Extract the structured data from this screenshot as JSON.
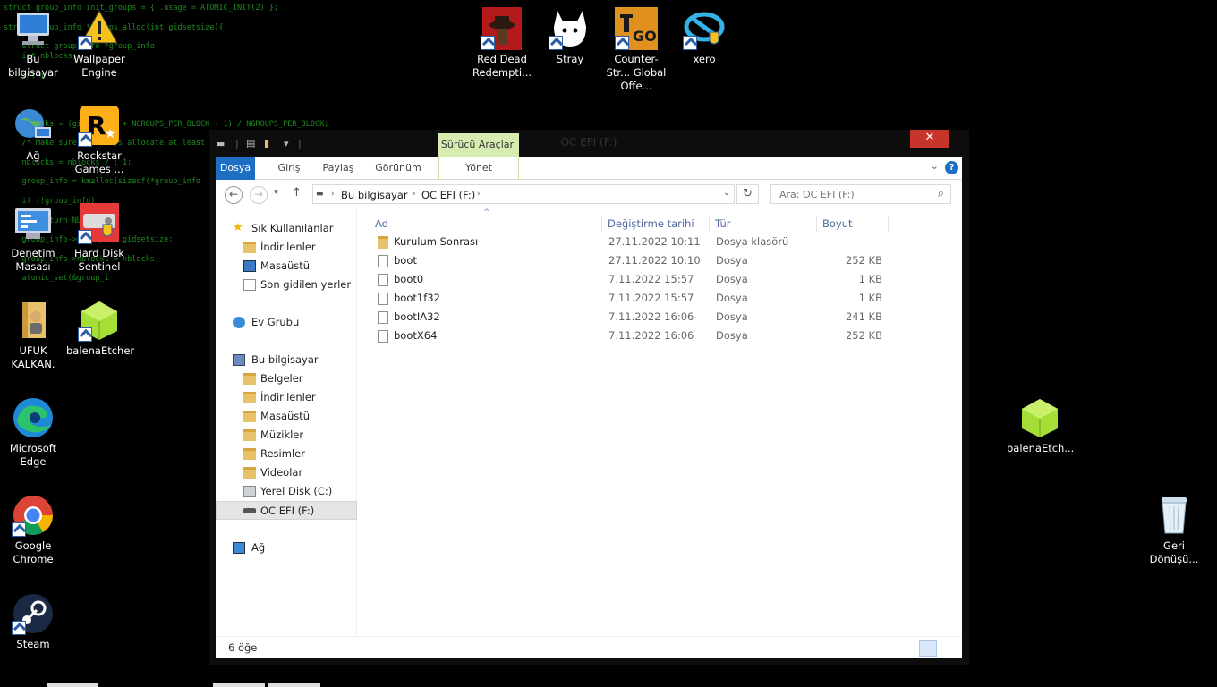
{
  "desktop": {
    "code_lines": [
      "struct group_info init_groups = { .usage = ATOMIC_INIT(2) };",
      "",
      "struct group_info *groups_alloc(int gidsetsize){",
      "",
      "    struct group_info *group_info;",
      "    int nblocks;",
      "",
      "    int i;",
      "",
      "",
      "",
      "",
      "    nblocks = (gidsetsize + NGROUPS_PER_BLOCK - 1) / NGROUPS_PER_BLOCK;",
      "",
      "    /* Make sure we always allocate at least",
      "",
      "    nblocks = nblocks ? : 1;",
      "",
      "    group_info = kmalloc(sizeof(*group_info",
      "",
      "    if (!group_info)",
      "",
      "        return NULL;",
      "",
      "    group_info->ngroups = gidsetsize;",
      "",
      "    group_info->nblocks = nblocks;",
      "",
      "    atomic_set(&group_i"
    ],
    "icons": [
      {
        "label": "Bu bilgisayar",
        "icon": "computer-icon"
      },
      {
        "label": "Wallpaper Engine",
        "icon": "wallpaper-engine-icon"
      },
      {
        "label": "Ağ",
        "icon": "network-globe-icon"
      },
      {
        "label": "Rockstar Games ...",
        "icon": "rockstar-icon"
      },
      {
        "label": "Denetim Masası",
        "icon": "control-panel-icon"
      },
      {
        "label": "Hard Disk Sentinel",
        "icon": "hard-disk-sentinel-icon"
      },
      {
        "label": "UFUK KALKAN.",
        "icon": "user-folder-icon"
      },
      {
        "label": "balenaEtcher",
        "icon": "balena-etcher-icon"
      },
      {
        "label": "Microsoft Edge",
        "icon": "edge-icon"
      },
      {
        "label": "Google Chrome",
        "icon": "chrome-icon"
      },
      {
        "label": "Steam",
        "icon": "steam-icon"
      },
      {
        "label": "Red Dead Redempti...",
        "icon": "red-dead-icon"
      },
      {
        "label": "Stray",
        "icon": "stray-icon"
      },
      {
        "label": "Counter-Str... Global Offe...",
        "icon": "csgo-icon"
      },
      {
        "label": "xero",
        "icon": "xero-icon"
      },
      {
        "label": "balenaEtch...",
        "icon": "balena-etcher-icon"
      },
      {
        "label": "Geri Dönüşü...",
        "icon": "recycle-bin-icon"
      }
    ]
  },
  "window": {
    "title": "OC EFI (F:)",
    "context_tab_group": "Sürücü Araçları",
    "ribbon_tabs": [
      "Dosya",
      "Giriş",
      "Paylaş",
      "Görünüm",
      "Yönet"
    ],
    "close_glyph": "✕",
    "address": {
      "segments": [
        "Bu bilgisayar",
        "OC EFI (F:)"
      ],
      "search_placeholder": "Ara: OC EFI (F:)"
    },
    "nav": {
      "favorites_label": "Sık Kullanılanlar",
      "favorites": [
        "İndirilenler",
        "Masaüstü",
        "Son gidilen yerler"
      ],
      "homegroup": "Ev Grubu",
      "this_pc": "Bu bilgisayar",
      "pc_items": [
        "Belgeler",
        "İndirilenler",
        "Masaüstü",
        "Müzikler",
        "Resimler",
        "Videolar",
        "Yerel Disk (C:)",
        "OC EFI (F:)"
      ],
      "network": "Ağ"
    },
    "columns": [
      "Ad",
      "Değiştirme tarihi",
      "Tür",
      "Boyut"
    ],
    "files": [
      {
        "name": "Kurulum Sonrası",
        "date": "27.11.2022 10:11",
        "type": "Dosya klasörü",
        "size": "",
        "kind": "folder"
      },
      {
        "name": "boot",
        "date": "27.11.2022 10:10",
        "type": "Dosya",
        "size": "252 KB",
        "kind": "file"
      },
      {
        "name": "boot0",
        "date": "7.11.2022 15:57",
        "type": "Dosya",
        "size": "1 KB",
        "kind": "file"
      },
      {
        "name": "boot1f32",
        "date": "7.11.2022 15:57",
        "type": "Dosya",
        "size": "1 KB",
        "kind": "file"
      },
      {
        "name": "bootIA32",
        "date": "7.11.2022 16:06",
        "type": "Dosya",
        "size": "241 KB",
        "kind": "file"
      },
      {
        "name": "bootX64",
        "date": "7.11.2022 16:06",
        "type": "Dosya",
        "size": "252 KB",
        "kind": "file"
      }
    ],
    "status": "6 öğe"
  }
}
